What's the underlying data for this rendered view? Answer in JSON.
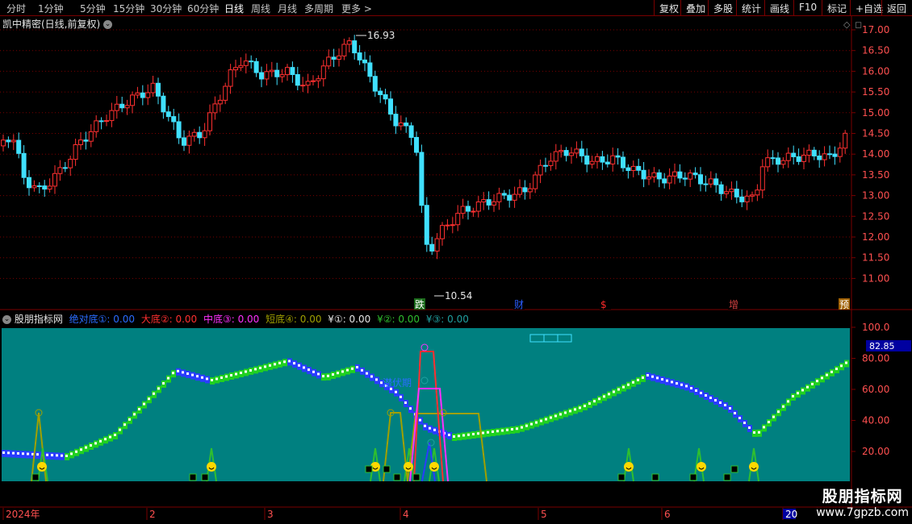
{
  "toolbar": {
    "periods": [
      "分时",
      "1分钟",
      "5分钟",
      "15分钟",
      "30分钟",
      "60分钟",
      "日线",
      "周线",
      "月线",
      "多周期",
      "更多 >"
    ],
    "active_period": "日线",
    "right_buttons": [
      "复权",
      "叠加",
      "多股",
      "统计",
      "画线",
      "F10",
      "标记",
      "+自选",
      "返回"
    ]
  },
  "chart_title": "凯中精密(日线,前复权)",
  "price_axis": [
    "17.00",
    "16.50",
    "16.00",
    "15.50",
    "15.00",
    "14.50",
    "14.00",
    "13.50",
    "13.00",
    "12.50",
    "12.00",
    "11.50",
    "11.00"
  ],
  "high_label": "16.93",
  "low_label": "10.54",
  "event_markers": [
    {
      "label": "跌",
      "color": "#2fbf2f"
    },
    {
      "label": "财",
      "color": "#2a5cff"
    },
    {
      "label": "$",
      "color": "#ff2a2a"
    },
    {
      "label": "增",
      "color": "#d04040"
    },
    {
      "label": "预",
      "color": "#e08a00"
    }
  ],
  "indicator": {
    "name": "股朋指标网",
    "values": [
      {
        "label": "绝对底①: 0.00",
        "color": "#2a6cff"
      },
      {
        "label": "大底②: 0.00",
        "color": "#ff3030"
      },
      {
        "label": "中底③: 0.00",
        "color": "#ff30ff"
      },
      {
        "label": "短底④: 0.00",
        "color": "#a0a000"
      },
      {
        "label": "¥①: 0.00",
        "color": "#e6e6e6"
      },
      {
        "label": "¥②: 0.00",
        "color": "#2fbf2f"
      },
      {
        "label": "¥③: 0.00",
        "color": "#20a0a0"
      }
    ],
    "axis": [
      "100.0",
      "80.00",
      "60.00",
      "40.00",
      "20.00"
    ],
    "current_value": "82.85",
    "annotation": "潜伏期"
  },
  "date_axis": [
    "2024年",
    "2",
    "3",
    "4",
    "5",
    "6",
    "20"
  ],
  "watermark": {
    "line1": "股朋指标网",
    "line2": "www.7gpzb.com"
  },
  "colors": {
    "up": "#ff3030",
    "down": "#40e0ff",
    "grid": "#7a0000",
    "panel_bg": "#008080"
  }
}
